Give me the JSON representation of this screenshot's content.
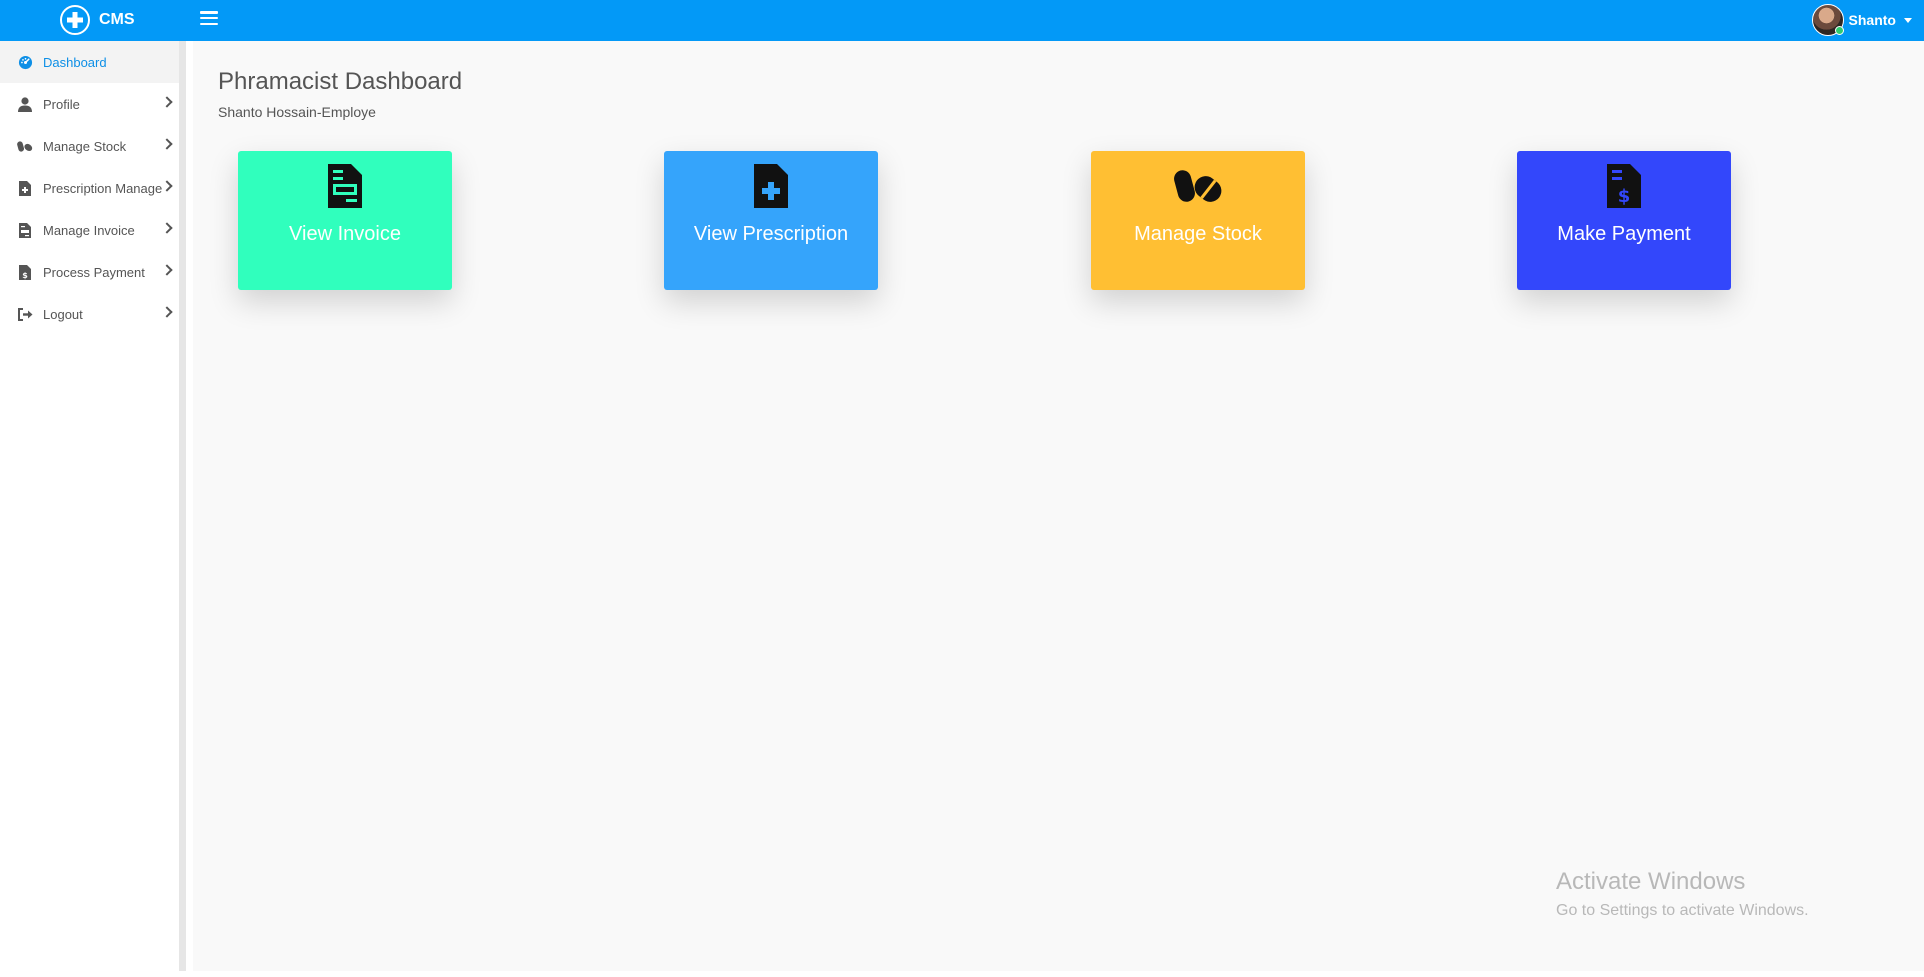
{
  "header": {
    "brand": "CMS",
    "user_name": "Shanto"
  },
  "sidebar": {
    "items": [
      {
        "label": "Dashboard",
        "icon": "dashboard-icon",
        "active": true
      },
      {
        "label": "Profile",
        "icon": "user-icon"
      },
      {
        "label": "Manage Stock",
        "icon": "pills-icon"
      },
      {
        "label": "Prescription Manage",
        "icon": "file-medical-icon"
      },
      {
        "label": "Manage Invoice",
        "icon": "file-invoice-icon"
      },
      {
        "label": "Process Payment",
        "icon": "file-dollar-icon"
      },
      {
        "label": "Logout",
        "icon": "sign-out-icon"
      }
    ]
  },
  "main": {
    "title": "Phramacist Dashboard",
    "subtitle": "Shanto Hossain-Employe",
    "cards": [
      {
        "label": "View Invoice",
        "icon": "file-invoice-icon",
        "color": "#30ffbd"
      },
      {
        "label": "View Prescription",
        "icon": "file-medical-icon",
        "color": "#35a4fb"
      },
      {
        "label": "Manage Stock",
        "icon": "pills-icon",
        "color": "#ffbf33"
      },
      {
        "label": "Make Payment",
        "icon": "file-dollar-icon",
        "color": "#3347fb"
      }
    ]
  },
  "watermark": {
    "title": "Activate Windows",
    "subtitle": "Go to Settings to activate Windows."
  },
  "colors": {
    "topbar": "#0399f7",
    "active_nav": "#0d8fe6"
  }
}
